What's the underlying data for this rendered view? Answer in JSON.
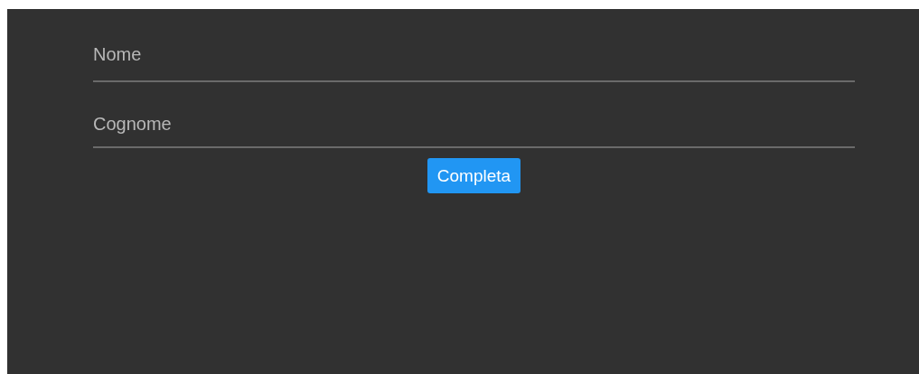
{
  "form": {
    "fields": [
      {
        "placeholder": "Nome"
      },
      {
        "placeholder": "Cognome"
      }
    ],
    "submit_button": "Completa"
  }
}
